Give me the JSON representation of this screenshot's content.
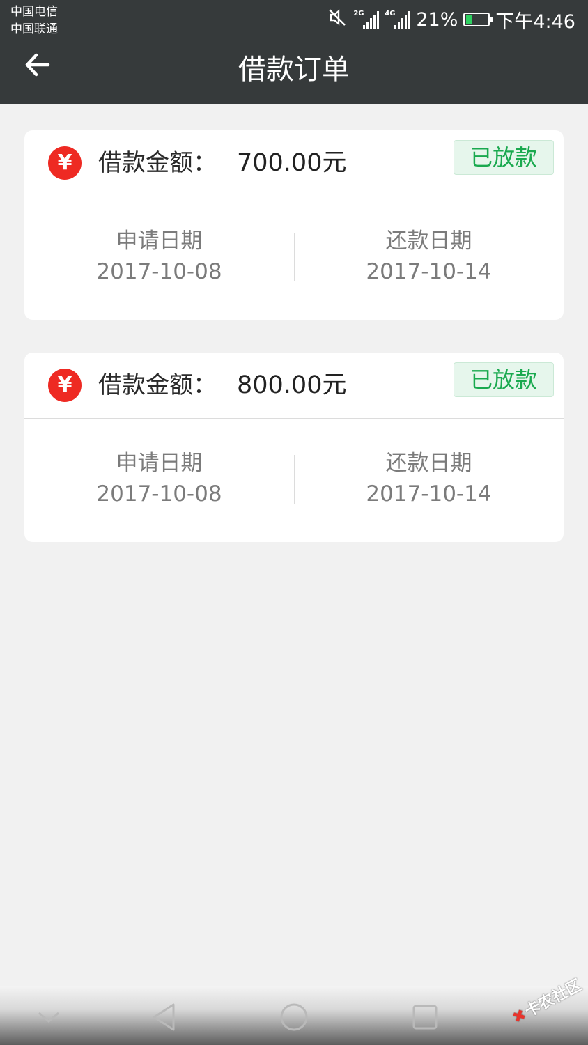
{
  "status_bar": {
    "carrier_1": "中国电信",
    "carrier_2": "中国联通",
    "signal_1_tag": "2G",
    "signal_2_tag": "4G",
    "battery_percent": "21%",
    "time": "下午4:46"
  },
  "header": {
    "title": "借款订单"
  },
  "orders": [
    {
      "icon": "¥",
      "amount_label": "借款金额：",
      "amount": "700.00元",
      "status": "已放款",
      "apply_label": "申请日期",
      "apply_date": "2017-10-08",
      "repay_label": "还款日期",
      "repay_date": "2017-10-14"
    },
    {
      "icon": "¥",
      "amount_label": "借款金额：",
      "amount": "800.00元",
      "status": "已放款",
      "apply_label": "申请日期",
      "apply_date": "2017-10-08",
      "repay_label": "还款日期",
      "repay_date": "2017-10-14"
    }
  ],
  "watermark": {
    "text": "卡农社区"
  },
  "colors": {
    "header_bg": "#363a3b",
    "page_bg": "#f1f1f1",
    "yen_red": "#ee2a23",
    "status_green": "#1aa94f",
    "badge_bg": "#e6f6ec"
  }
}
